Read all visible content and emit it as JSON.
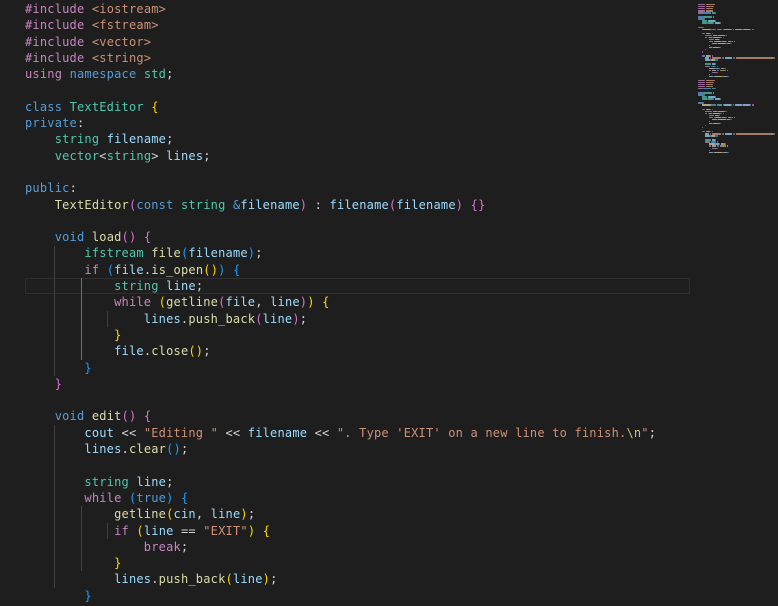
{
  "editor": {
    "lines": [
      [
        [
          "inc",
          "#include"
        ],
        [
          "txt",
          " "
        ],
        [
          "hdr",
          "<iostream>"
        ]
      ],
      [
        [
          "inc",
          "#include"
        ],
        [
          "txt",
          " "
        ],
        [
          "hdr",
          "<fstream>"
        ]
      ],
      [
        [
          "inc",
          "#include"
        ],
        [
          "txt",
          " "
        ],
        [
          "hdr",
          "<vector>"
        ]
      ],
      [
        [
          "inc",
          "#include"
        ],
        [
          "txt",
          " "
        ],
        [
          "hdr",
          "<string>"
        ]
      ],
      [
        [
          "ctl",
          "using"
        ],
        [
          "txt",
          " "
        ],
        [
          "kw",
          "namespace"
        ],
        [
          "txt",
          " "
        ],
        [
          "typ",
          "std"
        ],
        [
          "txt",
          ";"
        ]
      ],
      [],
      [
        [
          "kw",
          "class"
        ],
        [
          "txt",
          " "
        ],
        [
          "typ",
          "TextEditor"
        ],
        [
          "txt",
          " "
        ],
        [
          "br1",
          "{"
        ]
      ],
      [
        [
          "kw",
          "private"
        ],
        [
          "txt",
          ":"
        ]
      ],
      [
        [
          "txt",
          "    "
        ],
        [
          "typ",
          "string"
        ],
        [
          "txt",
          " "
        ],
        [
          "var",
          "filename"
        ],
        [
          "txt",
          ";"
        ]
      ],
      [
        [
          "txt",
          "    "
        ],
        [
          "typ",
          "vector"
        ],
        [
          "txt",
          "<"
        ],
        [
          "typ",
          "string"
        ],
        [
          "txt",
          "> "
        ],
        [
          "var",
          "lines"
        ],
        [
          "txt",
          ";"
        ]
      ],
      [],
      [
        [
          "kw",
          "public"
        ],
        [
          "txt",
          ":"
        ]
      ],
      [
        [
          "txt",
          "    "
        ],
        [
          "fn",
          "TextEditor"
        ],
        [
          "br2",
          "("
        ],
        [
          "kw",
          "const"
        ],
        [
          "txt",
          " "
        ],
        [
          "typ",
          "string"
        ],
        [
          "txt",
          " "
        ],
        [
          "kw",
          "&"
        ],
        [
          "var",
          "filename"
        ],
        [
          "br2",
          ")"
        ],
        [
          "txt",
          " : "
        ],
        [
          "var",
          "filename"
        ],
        [
          "br2",
          "("
        ],
        [
          "var",
          "filename"
        ],
        [
          "br2",
          ")"
        ],
        [
          "txt",
          " "
        ],
        [
          "br2",
          "{}"
        ]
      ],
      [],
      [
        [
          "txt",
          "    "
        ],
        [
          "kw",
          "void"
        ],
        [
          "txt",
          " "
        ],
        [
          "fn",
          "load"
        ],
        [
          "br2",
          "()"
        ],
        [
          "txt",
          " "
        ],
        [
          "br2",
          "{"
        ]
      ],
      [
        [
          "txt",
          "        "
        ],
        [
          "typ",
          "ifstream"
        ],
        [
          "txt",
          " "
        ],
        [
          "fn",
          "file"
        ],
        [
          "br3",
          "("
        ],
        [
          "var",
          "filename"
        ],
        [
          "br3",
          ")"
        ],
        [
          "txt",
          ";"
        ]
      ],
      [
        [
          "txt",
          "        "
        ],
        [
          "ctl",
          "if"
        ],
        [
          "txt",
          " "
        ],
        [
          "br3",
          "("
        ],
        [
          "var",
          "file"
        ],
        [
          "txt",
          "."
        ],
        [
          "fn",
          "is_open"
        ],
        [
          "br1",
          "()"
        ],
        [
          "br3",
          ")"
        ],
        [
          "txt",
          " "
        ],
        [
          "br3",
          "{"
        ]
      ],
      [
        [
          "txt",
          "            "
        ],
        [
          "typ",
          "string"
        ],
        [
          "txt",
          " "
        ],
        [
          "var",
          "line"
        ],
        [
          "txt",
          ";"
        ]
      ],
      [
        [
          "txt",
          "            "
        ],
        [
          "ctl",
          "while"
        ],
        [
          "txt",
          " "
        ],
        [
          "br1",
          "("
        ],
        [
          "fn",
          "getline"
        ],
        [
          "br2",
          "("
        ],
        [
          "var",
          "file"
        ],
        [
          "txt",
          ", "
        ],
        [
          "var",
          "line"
        ],
        [
          "br2",
          ")"
        ],
        [
          "br1",
          ")"
        ],
        [
          "txt",
          " "
        ],
        [
          "br1",
          "{"
        ]
      ],
      [
        [
          "txt",
          "                "
        ],
        [
          "var",
          "lines"
        ],
        [
          "txt",
          "."
        ],
        [
          "fn",
          "push_back"
        ],
        [
          "br2",
          "("
        ],
        [
          "var",
          "line"
        ],
        [
          "br2",
          ")"
        ],
        [
          "txt",
          ";"
        ]
      ],
      [
        [
          "txt",
          "            "
        ],
        [
          "br1",
          "}"
        ]
      ],
      [
        [
          "txt",
          "            "
        ],
        [
          "var",
          "file"
        ],
        [
          "txt",
          "."
        ],
        [
          "fn",
          "close"
        ],
        [
          "br1",
          "()"
        ],
        [
          "txt",
          ";"
        ]
      ],
      [
        [
          "txt",
          "        "
        ],
        [
          "br3",
          "}"
        ]
      ],
      [
        [
          "txt",
          "    "
        ],
        [
          "br2",
          "}"
        ]
      ],
      [],
      [
        [
          "txt",
          "    "
        ],
        [
          "kw",
          "void"
        ],
        [
          "txt",
          " "
        ],
        [
          "fn",
          "edit"
        ],
        [
          "br2",
          "()"
        ],
        [
          "txt",
          " "
        ],
        [
          "br2",
          "{"
        ]
      ],
      [
        [
          "txt",
          "        "
        ],
        [
          "var",
          "cout"
        ],
        [
          "txt",
          " << "
        ],
        [
          "str",
          "\"Editing \""
        ],
        [
          "txt",
          " << "
        ],
        [
          "var",
          "filename"
        ],
        [
          "txt",
          " << "
        ],
        [
          "str",
          "\". Type 'EXIT' on a new line to finish."
        ],
        [
          "esc",
          "\\n"
        ],
        [
          "str",
          "\""
        ],
        [
          "txt",
          ";"
        ]
      ],
      [
        [
          "txt",
          "        "
        ],
        [
          "var",
          "lines"
        ],
        [
          "txt",
          "."
        ],
        [
          "fn",
          "clear"
        ],
        [
          "br3",
          "()"
        ],
        [
          "txt",
          ";"
        ]
      ],
      [],
      [
        [
          "txt",
          "        "
        ],
        [
          "typ",
          "string"
        ],
        [
          "txt",
          " "
        ],
        [
          "var",
          "line"
        ],
        [
          "txt",
          ";"
        ]
      ],
      [
        [
          "txt",
          "        "
        ],
        [
          "ctl",
          "while"
        ],
        [
          "txt",
          " "
        ],
        [
          "br3",
          "("
        ],
        [
          "kw",
          "true"
        ],
        [
          "br3",
          ")"
        ],
        [
          "txt",
          " "
        ],
        [
          "br3",
          "{"
        ]
      ],
      [
        [
          "txt",
          "            "
        ],
        [
          "fn",
          "getline"
        ],
        [
          "br1",
          "("
        ],
        [
          "var",
          "cin"
        ],
        [
          "txt",
          ", "
        ],
        [
          "var",
          "line"
        ],
        [
          "br1",
          ")"
        ],
        [
          "txt",
          ";"
        ]
      ],
      [
        [
          "txt",
          "            "
        ],
        [
          "ctl",
          "if"
        ],
        [
          "txt",
          " "
        ],
        [
          "br1",
          "("
        ],
        [
          "var",
          "line"
        ],
        [
          "txt",
          " == "
        ],
        [
          "str",
          "\"EXIT\""
        ],
        [
          "br1",
          ")"
        ],
        [
          "txt",
          " "
        ],
        [
          "br1",
          "{"
        ]
      ],
      [
        [
          "txt",
          "                "
        ],
        [
          "ctl",
          "break"
        ],
        [
          "txt",
          ";"
        ]
      ],
      [
        [
          "txt",
          "            "
        ],
        [
          "br1",
          "}"
        ]
      ],
      [
        [
          "txt",
          "            "
        ],
        [
          "var",
          "lines"
        ],
        [
          "txt",
          "."
        ],
        [
          "fn",
          "push_back"
        ],
        [
          "br1",
          "("
        ],
        [
          "var",
          "line"
        ],
        [
          "br1",
          ")"
        ],
        [
          "txt",
          ";"
        ]
      ],
      [
        [
          "txt",
          "        "
        ],
        [
          "br3",
          "}"
        ]
      ]
    ],
    "current_line_index": 17
  },
  "colors": {
    "background": "#1e1e1e",
    "keyword": "#569cd6",
    "control": "#c586c0",
    "string": "#ce9178",
    "type": "#4ec9b0",
    "function": "#dcdcaa",
    "variable": "#9cdcfe",
    "bracket_gold": "#ffd700",
    "bracket_orchid": "#da70d6",
    "bracket_blue": "#179fff"
  }
}
